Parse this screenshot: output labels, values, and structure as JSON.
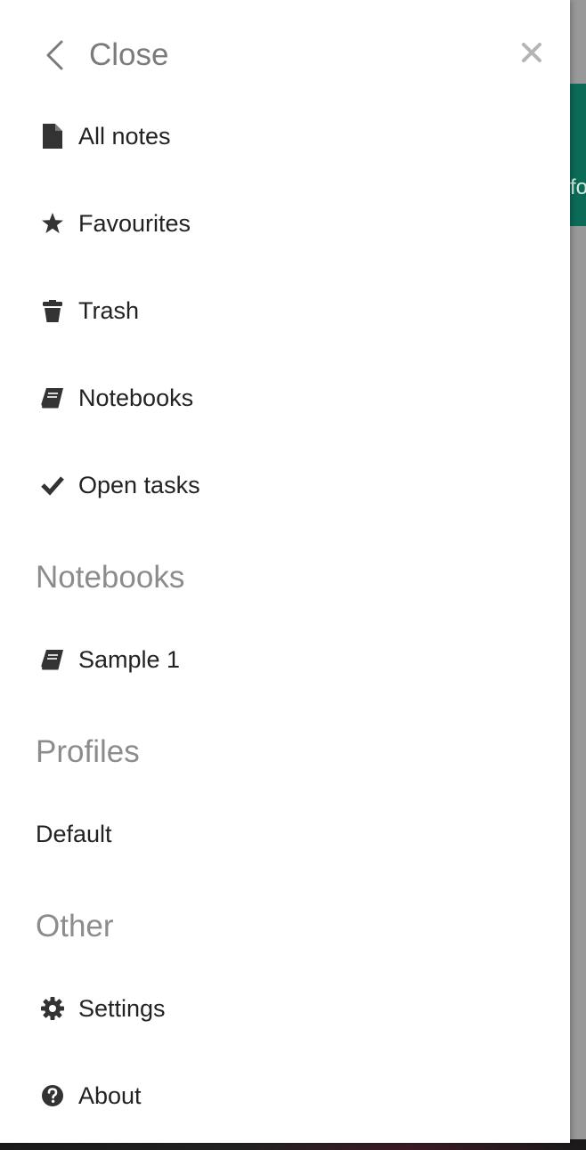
{
  "header": {
    "back_label": "Close"
  },
  "background": {
    "header_text": "fo",
    "accent_color": "#0b6b57"
  },
  "menu": [
    {
      "label": "All notes",
      "icon": "file-icon"
    },
    {
      "label": "Favourites",
      "icon": "star-icon"
    },
    {
      "label": "Trash",
      "icon": "trash-icon"
    },
    {
      "label": "Notebooks",
      "icon": "book-icon"
    },
    {
      "label": "Open tasks",
      "icon": "check-icon"
    }
  ],
  "notebooks": {
    "title": "Notebooks",
    "items": [
      {
        "label": "Sample 1",
        "icon": "book-icon"
      }
    ]
  },
  "profiles": {
    "title": "Profiles",
    "items": [
      {
        "label": "Default"
      }
    ]
  },
  "other": {
    "title": "Other",
    "items": [
      {
        "label": "Settings",
        "icon": "gear-icon"
      },
      {
        "label": "About",
        "icon": "question-circle-icon"
      }
    ]
  }
}
